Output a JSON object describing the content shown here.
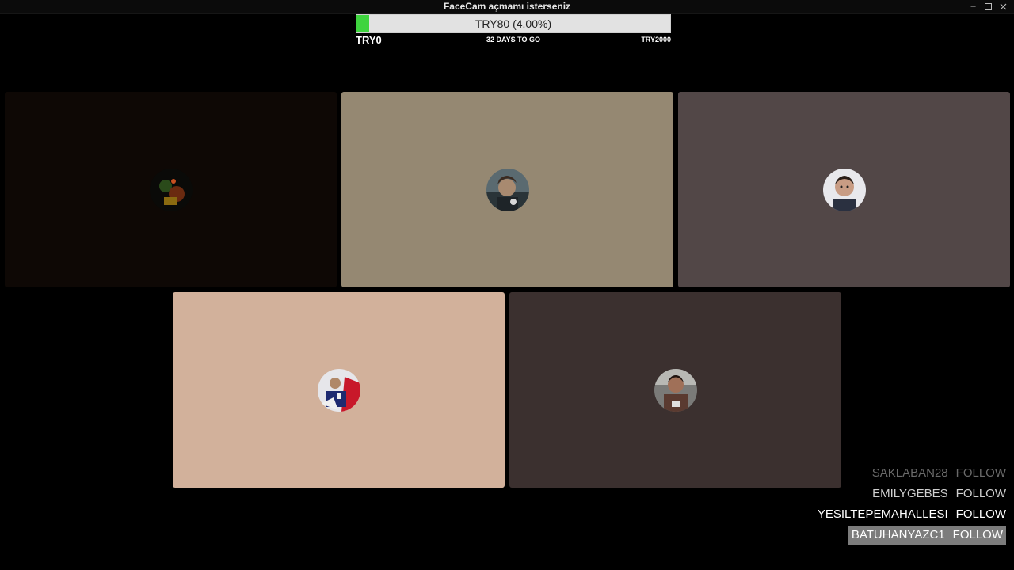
{
  "window": {
    "title": "FaceCam açmamı isterseniz"
  },
  "goal": {
    "bar_text": "TRY80 (4.00%)",
    "progress_percent": 4.0,
    "min_label": "TRY0",
    "days_label": "32 DAYS TO GO",
    "max_label": "TRY2000",
    "fill_color": "#3fd43f"
  },
  "tiles": [
    {
      "bg": "#0e0805"
    },
    {
      "bg": "#958872"
    },
    {
      "bg": "#524747"
    },
    {
      "bg": "#d2b19b"
    },
    {
      "bg": "#3b302f"
    }
  ],
  "followers": [
    {
      "name": "SAKLABAN28",
      "action": "FOLLOW"
    },
    {
      "name": "EMILYGEBES",
      "action": "FOLLOW"
    },
    {
      "name": "YESILTEPEMAHALLESI",
      "action": "FOLLOW"
    },
    {
      "name": "BATUHANYAZC1",
      "action": "FOLLOW"
    }
  ]
}
